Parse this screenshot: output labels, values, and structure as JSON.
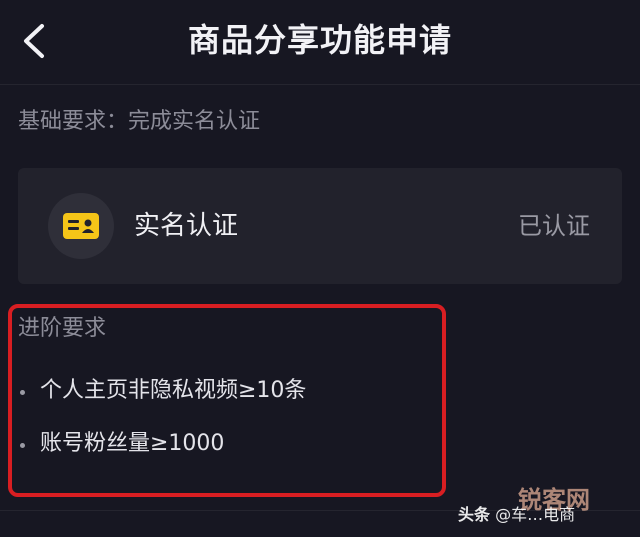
{
  "header": {
    "title": "商品分享功能申请",
    "back_icon": "chevron-left-icon"
  },
  "basic_requirement": {
    "text": "基础要求：完成实名认证"
  },
  "verification_card": {
    "icon": "id-card-icon",
    "label": "实名认证",
    "status": "已认证",
    "icon_color": "#f5c518"
  },
  "advanced_requirement": {
    "title": "进阶要求",
    "items": [
      "个人主页非隐私视频≥10条",
      "账号粉丝量≥1000"
    ],
    "highlight_color": "#d81e22"
  },
  "watermark": {
    "site": "锐客网",
    "source_brand": "头条",
    "source_suffix": "@车…电商"
  }
}
